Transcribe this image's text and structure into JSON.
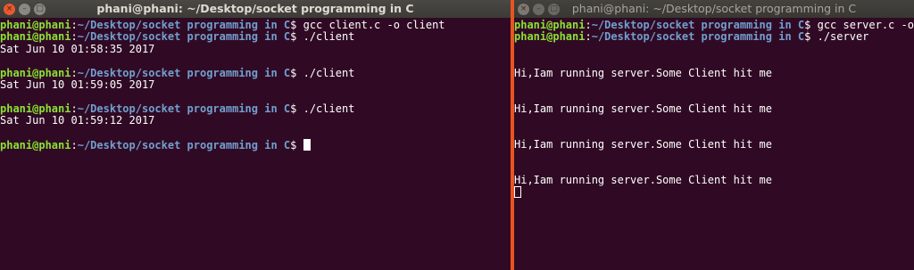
{
  "left": {
    "title": "phani@phani: ~/Desktop/socket programming in C",
    "lines": [
      {
        "user": "phani@phani",
        "path": "~/Desktop/socket programming in C",
        "cmd": "$ gcc client.c -o client"
      },
      {
        "user": "phani@phani",
        "path": "~/Desktop/socket programming in C",
        "cmd": "$ ./client"
      },
      {
        "text": "Sat Jun 10 01:58:35 2017"
      },
      {
        "text": ""
      },
      {
        "user": "phani@phani",
        "path": "~/Desktop/socket programming in C",
        "cmd": "$ ./client"
      },
      {
        "text": "Sat Jun 10 01:59:05 2017"
      },
      {
        "text": ""
      },
      {
        "user": "phani@phani",
        "path": "~/Desktop/socket programming in C",
        "cmd": "$ ./client"
      },
      {
        "text": "Sat Jun 10 01:59:12 2017"
      },
      {
        "text": ""
      },
      {
        "user": "phani@phani",
        "path": "~/Desktop/socket programming in C",
        "cmd": "$ ",
        "cursor": "solid"
      }
    ]
  },
  "right": {
    "title": "phani@phani: ~/Desktop/socket programming in C",
    "lines": [
      {
        "user": "phani@phani",
        "path": "~/Desktop/socket programming in C",
        "cmd": "$ gcc server.c -o server"
      },
      {
        "user": "phani@phani",
        "path": "~/Desktop/socket programming in C",
        "cmd": "$ ./server"
      },
      {
        "text": ""
      },
      {
        "text": ""
      },
      {
        "text": "Hi,Iam running server.Some Client hit me"
      },
      {
        "text": ""
      },
      {
        "text": ""
      },
      {
        "text": "Hi,Iam running server.Some Client hit me"
      },
      {
        "text": ""
      },
      {
        "text": ""
      },
      {
        "text": "Hi,Iam running server.Some Client hit me"
      },
      {
        "text": ""
      },
      {
        "text": ""
      },
      {
        "text": "Hi,Iam running server.Some Client hit me"
      },
      {
        "text": "",
        "cursor": "hollow"
      }
    ]
  },
  "controls": {
    "close": "×",
    "minimize": "–",
    "maximize": "□"
  },
  "colors": {
    "terminal_bg": "#300a24",
    "user": "#8ae234",
    "path": "#729fcf",
    "divider": "#e95420"
  }
}
